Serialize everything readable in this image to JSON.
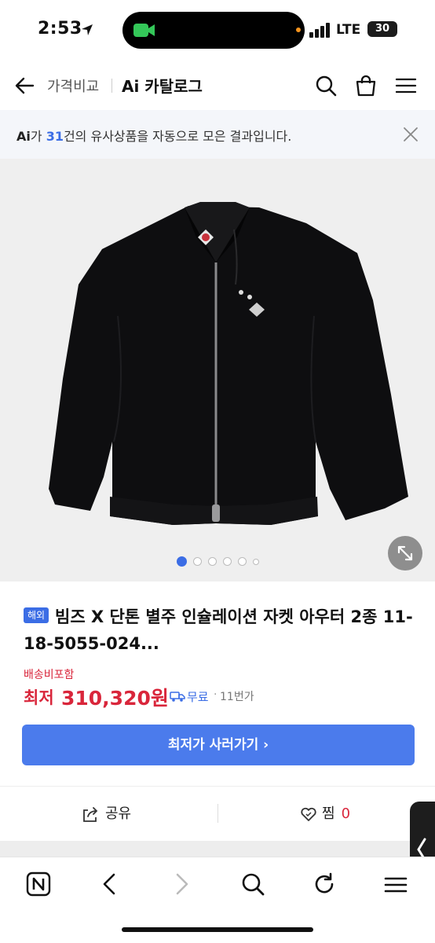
{
  "status": {
    "time": "2:53",
    "network": "LTE",
    "battery": "30"
  },
  "nav": {
    "subtitle": "가격비교",
    "title": "Ai 카탈로그"
  },
  "ai_banner": {
    "prefix": "Ai",
    "mid": "가 ",
    "count": "31",
    "suffix": "건의 유사상품을 자동으로 모은 결과입니다."
  },
  "gallery": {
    "total_images": 7,
    "active_index": 0
  },
  "product": {
    "badge": "해외",
    "title": "빔즈 X 단톤 별주 인슐레이션 자켓 아우터 2종 11-18-5055-024...",
    "shipping_note": "배송비포함",
    "price_label": "최저",
    "price": "310,320원",
    "delivery": "무료",
    "shop": "11번가",
    "buy_button": "최저가 사러가기 ›"
  },
  "actions": {
    "share": "공유",
    "zzim": "찜",
    "zzim_count": "0"
  },
  "colors": {
    "accent_blue": "#4b7bec",
    "price_red": "#d9263b",
    "banner_bg": "#f4f6fa"
  }
}
